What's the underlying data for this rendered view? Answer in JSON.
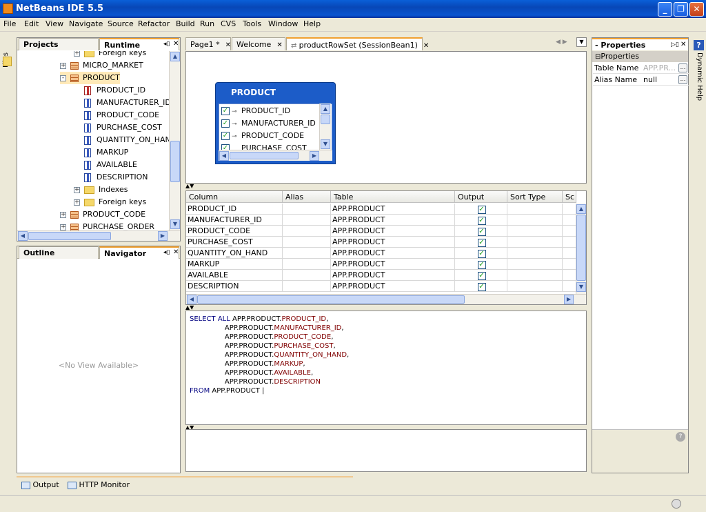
{
  "window": {
    "title": "NetBeans IDE 5.5"
  },
  "menu": [
    "File",
    "Edit",
    "View",
    "Navigate",
    "Source",
    "Refactor",
    "Build",
    "Run",
    "CVS",
    "Tools",
    "Window",
    "Help"
  ],
  "rails": {
    "left_label": "Files",
    "right_label": "Dynamic Help"
  },
  "explorer": {
    "tabs": [
      "Projects",
      "Runtime"
    ],
    "tree": [
      {
        "label": "Foreign keys",
        "type": "folder",
        "indent": 2,
        "expander": "+"
      },
      {
        "label": "MICRO_MARKET",
        "type": "table",
        "indent": 1,
        "expander": "+"
      },
      {
        "label": "PRODUCT",
        "type": "table",
        "indent": 1,
        "expander": "-"
      },
      {
        "label": "PRODUCT_ID",
        "type": "key",
        "indent": 2
      },
      {
        "label": "MANUFACTURER_ID",
        "type": "col",
        "indent": 2
      },
      {
        "label": "PRODUCT_CODE",
        "type": "col",
        "indent": 2
      },
      {
        "label": "PURCHASE_COST",
        "type": "col",
        "indent": 2
      },
      {
        "label": "QUANTITY_ON_HAND",
        "type": "col",
        "indent": 2
      },
      {
        "label": "MARKUP",
        "type": "col",
        "indent": 2
      },
      {
        "label": "AVAILABLE",
        "type": "col",
        "indent": 2
      },
      {
        "label": "DESCRIPTION",
        "type": "col",
        "indent": 2
      },
      {
        "label": "Indexes",
        "type": "folder",
        "indent": 2,
        "expander": "+"
      },
      {
        "label": "Foreign keys",
        "type": "folder",
        "indent": 2,
        "expander": "+"
      },
      {
        "label": "PRODUCT_CODE",
        "type": "table",
        "indent": 1,
        "expander": "+"
      },
      {
        "label": "PURCHASE_ORDER",
        "type": "table",
        "indent": 1,
        "expander": "+"
      }
    ]
  },
  "outline": {
    "tabs": [
      "Outline",
      "Navigator"
    ],
    "empty": "<No View Available>"
  },
  "editor": {
    "tabs": [
      {
        "label": "Page1 *"
      },
      {
        "label": "Welcome"
      },
      {
        "label": "productRowSet (SessionBean1)"
      }
    ],
    "table_box": {
      "title": "PRODUCT",
      "columns": [
        "PRODUCT_ID",
        "MANUFACTURER_ID",
        "PRODUCT_CODE",
        "PURCHASE_COST"
      ]
    },
    "grid": {
      "headers": [
        "Column",
        "Alias",
        "Table",
        "Output",
        "Sort Type",
        "Sc"
      ],
      "rows": [
        {
          "column": "PRODUCT_ID",
          "table": "APP.PRODUCT"
        },
        {
          "column": "MANUFACTURER_ID",
          "table": "APP.PRODUCT"
        },
        {
          "column": "PRODUCT_CODE",
          "table": "APP.PRODUCT"
        },
        {
          "column": "PURCHASE_COST",
          "table": "APP.PRODUCT"
        },
        {
          "column": "QUANTITY_ON_HAND",
          "table": "APP.PRODUCT"
        },
        {
          "column": "MARKUP",
          "table": "APP.PRODUCT"
        },
        {
          "column": "AVAILABLE",
          "table": "APP.PRODUCT"
        },
        {
          "column": "DESCRIPTION",
          "table": "APP.PRODUCT"
        }
      ]
    },
    "sql": {
      "select_kw": "SELECT ALL",
      "from_kw": "FROM",
      "from_table": "APP.PRODUCT",
      "prefix": "APP.PRODUCT.",
      "fields": [
        "PRODUCT_ID",
        "MANUFACTURER_ID",
        "PRODUCT_CODE",
        "PURCHASE_COST",
        "QUANTITY_ON_HAND",
        "MARKUP",
        "AVAILABLE",
        "DESCRIPTION"
      ]
    }
  },
  "properties": {
    "title": "- Properties",
    "section": "Properties",
    "rows": [
      {
        "name": "Table Name",
        "value": "APP.PR..."
      },
      {
        "name": "Alias Name",
        "value": "null"
      }
    ]
  },
  "bottom": {
    "output_label": "Output",
    "http_label": "HTTP Monitor"
  },
  "colors": {
    "accent": "#f0a030",
    "titlebar": "#0a55d0"
  }
}
